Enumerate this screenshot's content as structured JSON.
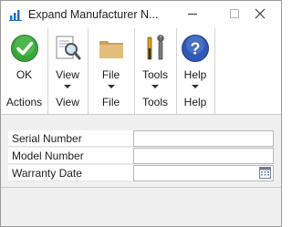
{
  "window": {
    "title": "Expand Manufacturer N..."
  },
  "ribbon": {
    "groups": [
      {
        "label": "Actions",
        "button": {
          "label": "OK",
          "icon": "ok-check-icon"
        }
      },
      {
        "label": "View",
        "button": {
          "label": "View",
          "icon": "view-magnifier-icon",
          "dropdown": true
        }
      },
      {
        "label": "File",
        "button": {
          "label": "File",
          "icon": "folder-icon",
          "dropdown": true
        }
      },
      {
        "label": "Tools",
        "button": {
          "label": "Tools",
          "icon": "tools-icon",
          "dropdown": true
        }
      },
      {
        "label": "Help",
        "button": {
          "label": "Help",
          "icon": "help-question-icon",
          "dropdown": true
        }
      }
    ]
  },
  "form": {
    "fields": [
      {
        "label": "Serial Number",
        "value": ""
      },
      {
        "label": "Model Number",
        "value": ""
      },
      {
        "label": "Warranty Date",
        "value": "",
        "icon": "calendar-icon"
      }
    ]
  },
  "colors": {
    "ok_green": "#3aa63a",
    "help_blue": "#2f59b5",
    "folder_tan": "#d9b070"
  }
}
